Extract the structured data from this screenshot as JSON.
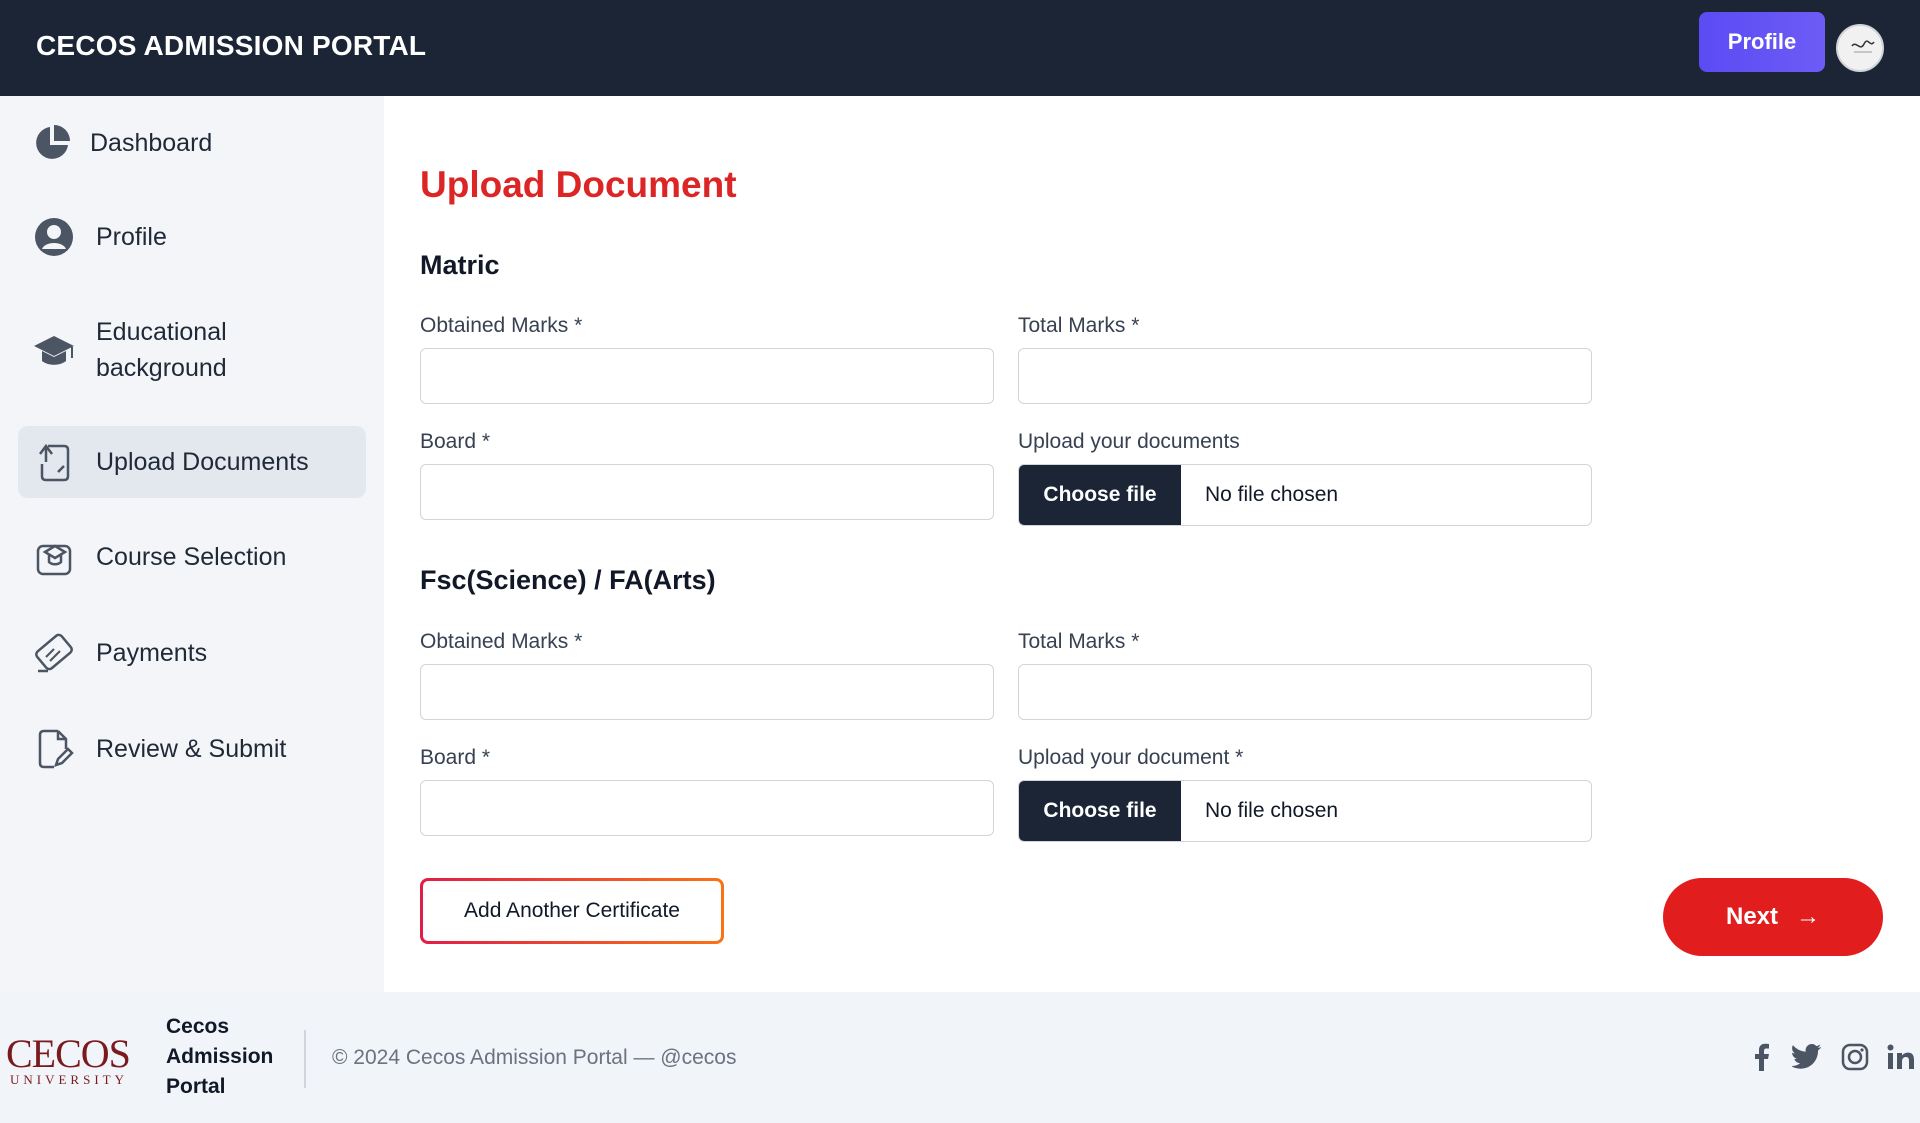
{
  "header": {
    "brand": "CECOS ADMISSION PORTAL",
    "profile_button": "Profile"
  },
  "sidebar": {
    "items": [
      {
        "label": "Dashboard",
        "icon": "pie-chart-icon"
      },
      {
        "label": "Profile",
        "icon": "user-circle-icon"
      },
      {
        "label": "Educational background",
        "icon": "graduation-cap-icon"
      },
      {
        "label": "Upload Documents",
        "icon": "upload-document-icon",
        "active": true
      },
      {
        "label": "Course Selection",
        "icon": "course-cap-icon"
      },
      {
        "label": "Payments",
        "icon": "ticket-icon"
      },
      {
        "label": "Review & Submit",
        "icon": "edit-document-icon"
      }
    ]
  },
  "main": {
    "title": "Upload Document",
    "sections": [
      {
        "title": "Matric",
        "obtained_label": "Obtained Marks *",
        "total_label": "Total Marks *",
        "board_label": "Board *",
        "upload_label": "Upload your documents",
        "choose_file": "Choose file",
        "file_status": "No file chosen"
      },
      {
        "title": "Fsc(Science) / FA(Arts)",
        "obtained_label": "Obtained Marks *",
        "total_label": "Total Marks *",
        "board_label": "Board *",
        "upload_label": "Upload your document *",
        "choose_file": "Choose file",
        "file_status": "No file chosen"
      }
    ],
    "add_certificate": "Add Another Certificate",
    "next": "Next",
    "next_arrow": "→"
  },
  "footer": {
    "logo_main": "CECOS",
    "logo_sub": "UNIVERSITY",
    "brand": "Cecos Admission Portal",
    "copyright": "© 2024 Cecos Admission Portal — @cecos",
    "social": [
      "facebook-icon",
      "twitter-icon",
      "instagram-icon",
      "linkedin-icon"
    ]
  },
  "colors": {
    "header_bg": "#1b2536",
    "accent_red": "#dc2626",
    "profile_purple": "#5b4bf3",
    "sidebar_bg": "#f3f5f8"
  }
}
